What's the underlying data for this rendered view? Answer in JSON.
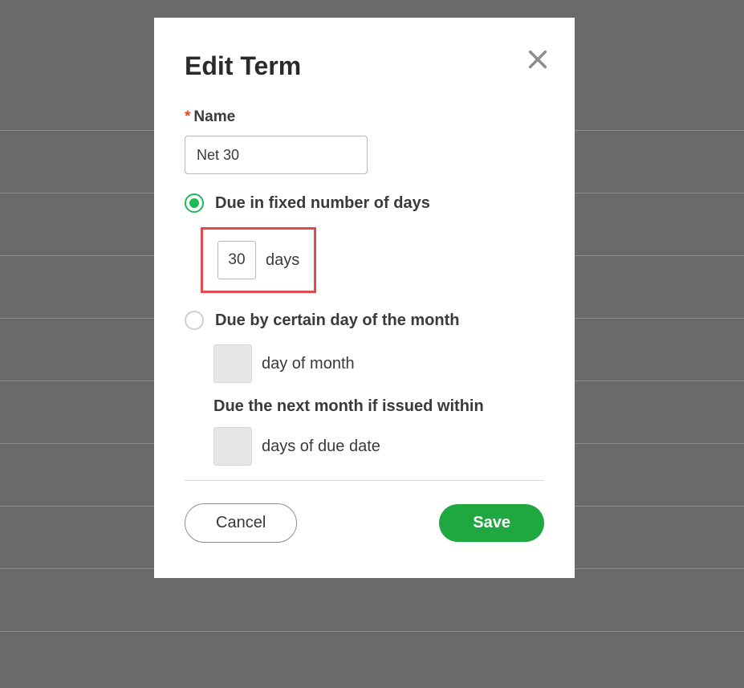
{
  "modal": {
    "title": "Edit Term",
    "name_label": "Name",
    "name_value": "Net 30",
    "option1": {
      "label": "Due in fixed number of days",
      "days_value": "30",
      "days_suffix": "days",
      "selected": true
    },
    "option2": {
      "label": "Due by certain day of the month",
      "sub1_suffix": "day of month",
      "sub2_label": "Due the next month if issued within",
      "sub2_suffix": "days of due date",
      "selected": false
    },
    "buttons": {
      "cancel": "Cancel",
      "save": "Save"
    }
  }
}
